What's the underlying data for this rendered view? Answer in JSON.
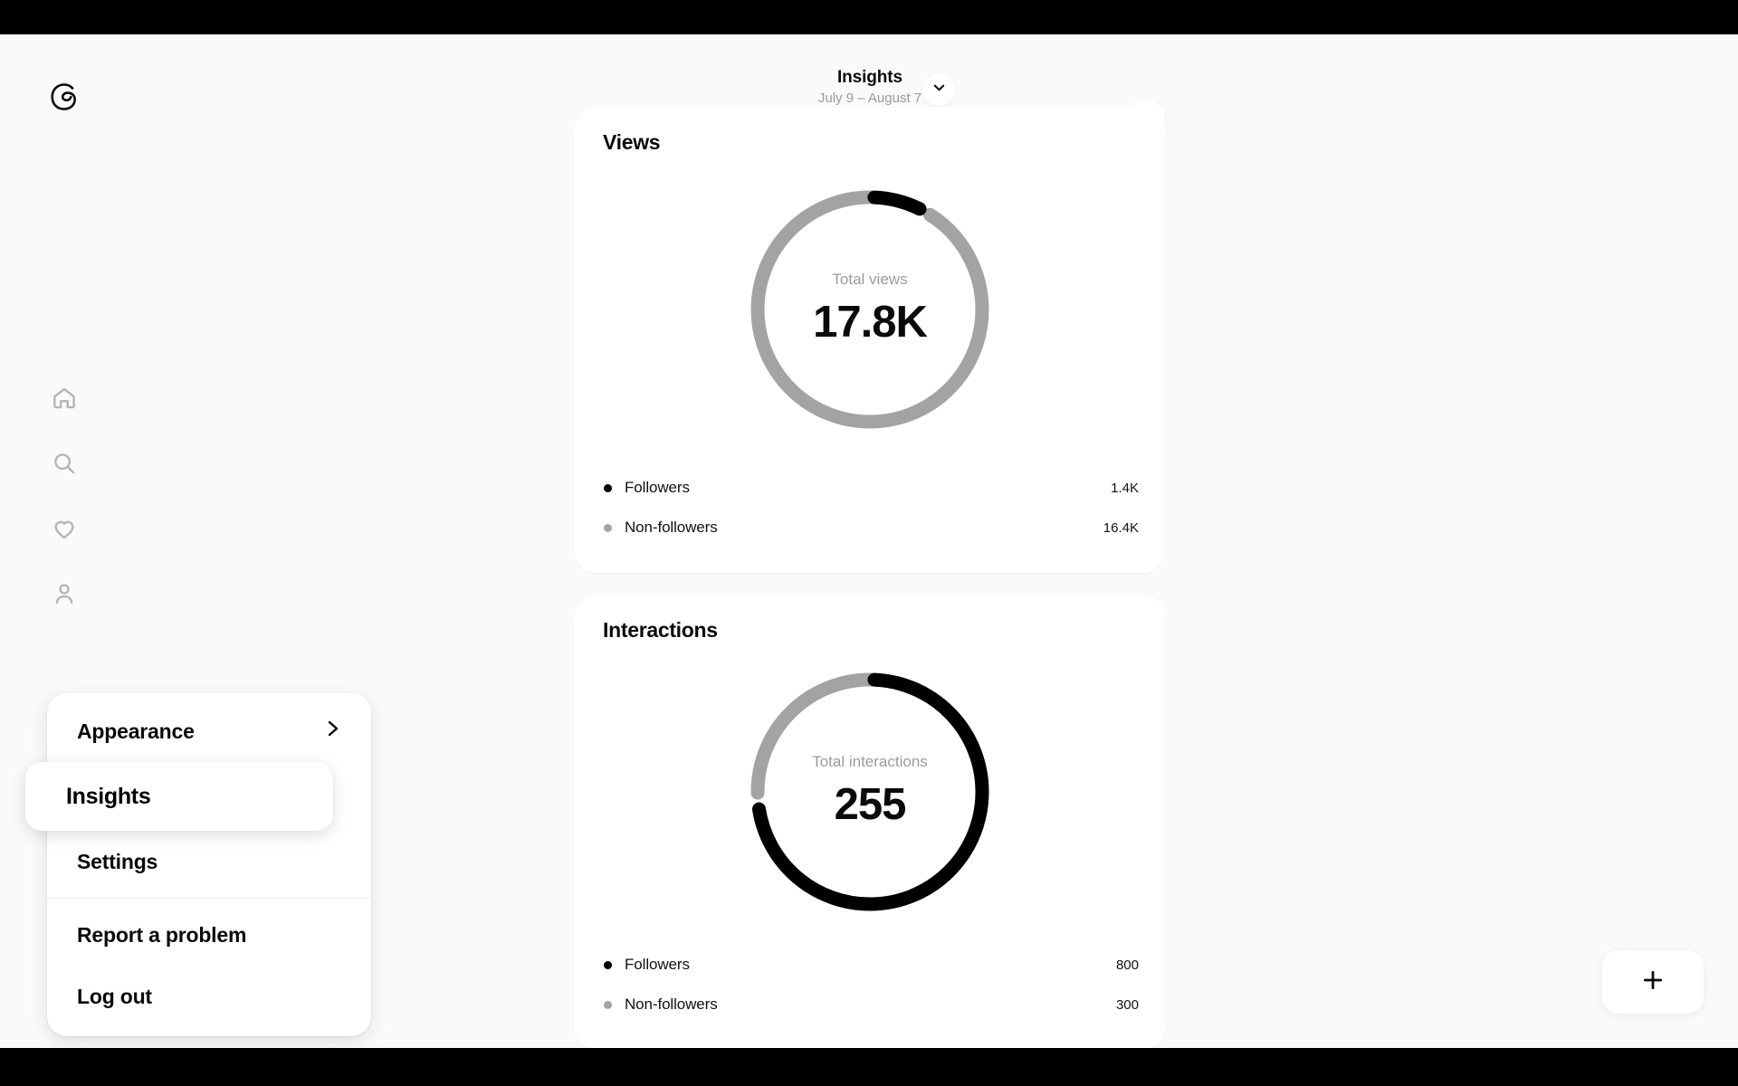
{
  "app": {
    "name": "Threads",
    "logo_icon": "threads-logo"
  },
  "sidebar": {
    "icons": [
      {
        "name": "home-icon",
        "label": "Home"
      },
      {
        "name": "search-icon",
        "label": "Search"
      },
      {
        "name": "heart-icon",
        "label": "Activity"
      },
      {
        "name": "profile-icon",
        "label": "Profile"
      }
    ],
    "menu": {
      "items": [
        {
          "label": "Appearance",
          "trailing_icon": "chevron-right-icon",
          "active": false
        },
        {
          "label": "Insights",
          "active": true
        },
        {
          "label": "Settings",
          "active": false
        },
        {
          "label": "Report a problem",
          "active": false
        },
        {
          "label": "Log out",
          "active": false
        }
      ]
    }
  },
  "header": {
    "title": "Insights",
    "subtitle": "July 9 – August 7",
    "chevron_icon": "chevron-down-icon",
    "more_icon": "more-options-icon",
    "more_label": "..."
  },
  "compose": {
    "icon": "plus-icon",
    "label": "+"
  },
  "cards": [
    {
      "title": "Views",
      "center_label": "Total views",
      "center_value": "17.8K",
      "legend": [
        {
          "name": "Followers",
          "value": "1.4K",
          "color": "#000000"
        },
        {
          "name": "Non-followers",
          "value": "16.4K",
          "color": "#a3a3a3"
        }
      ]
    },
    {
      "title": "Interactions",
      "center_label": "Total interactions",
      "center_value": "255",
      "legend": [
        {
          "name": "Followers",
          "value": "800",
          "color": "#000000"
        },
        {
          "name": "Non-followers",
          "value": "300",
          "color": "#a3a3a3"
        }
      ]
    }
  ],
  "chart_data": [
    {
      "type": "pie",
      "title": "Views",
      "center_label": "Total views",
      "center_value": "17.8K",
      "total": 17800,
      "labels": [
        "Followers",
        "Non-followers"
      ],
      "values": [
        1400,
        16400
      ],
      "colors": [
        "#000000",
        "#a3a3a3"
      ],
      "display_values": [
        "1.4K",
        "16.4K"
      ],
      "legend": "bottom",
      "donut": true
    },
    {
      "type": "pie",
      "title": "Interactions",
      "center_label": "Total interactions",
      "center_value": "255",
      "total": 1100,
      "labels": [
        "Followers",
        "Non-followers"
      ],
      "values": [
        800,
        300
      ],
      "colors": [
        "#000000",
        "#a3a3a3"
      ],
      "display_values": [
        "800",
        "300"
      ],
      "legend": "bottom",
      "donut": true
    }
  ],
  "colors": {
    "followers": "#000000",
    "non_followers": "#a3a3a3",
    "background": "#fafafa",
    "card": "#ffffff",
    "letterbox": "#000000"
  }
}
